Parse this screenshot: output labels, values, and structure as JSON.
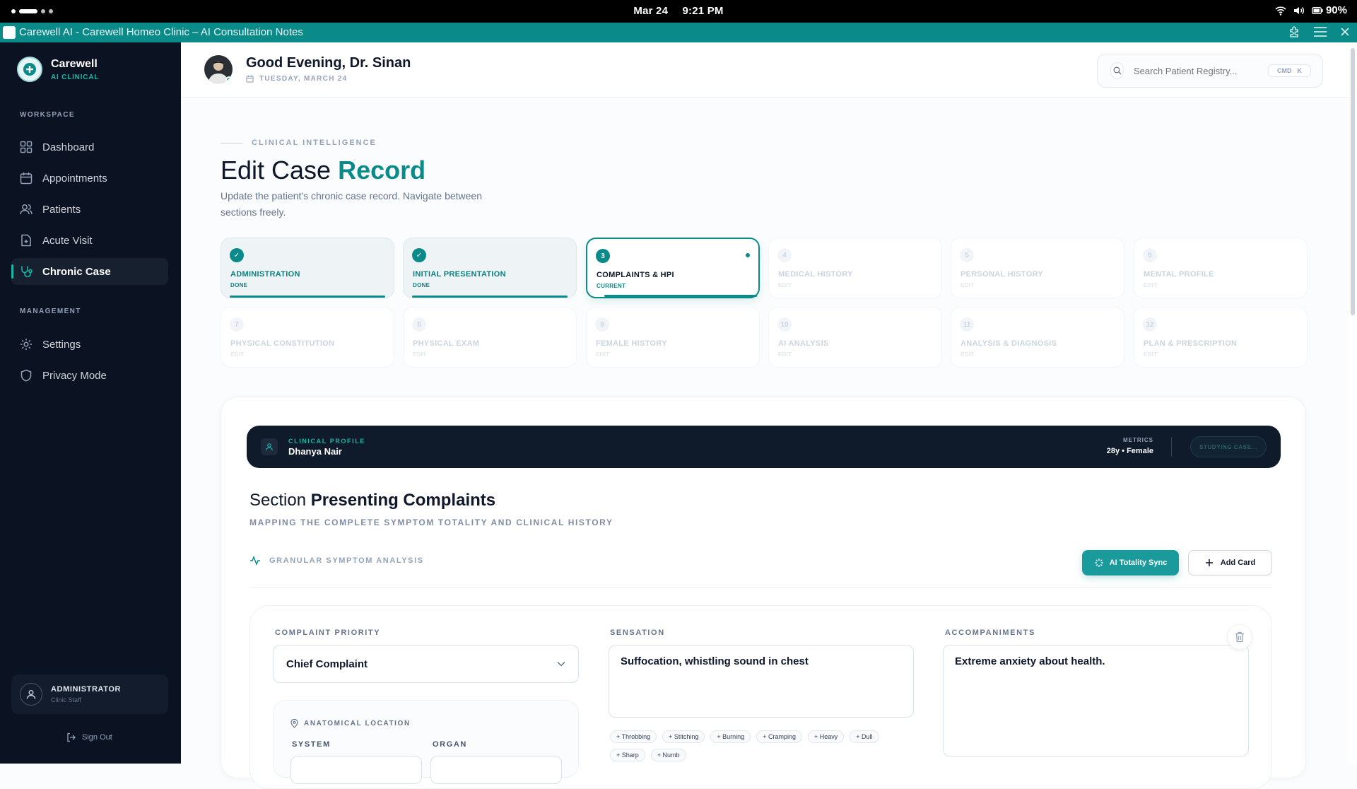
{
  "statusbar": {
    "date": "Mar 24",
    "time": "9:21 PM",
    "battery": "90%"
  },
  "window": {
    "title": "Carewell AI - Carewell Homeo Clinic – AI Consultation Notes"
  },
  "sidebar": {
    "brand": {
      "name": "Carewell",
      "sub": "AI CLINICAL"
    },
    "workspace_label": "WORKSPACE",
    "workspace_items": [
      {
        "label": "Dashboard",
        "icon": "grid-icon"
      },
      {
        "label": "Appointments",
        "icon": "calendar-icon"
      },
      {
        "label": "Patients",
        "icon": "users-icon"
      },
      {
        "label": "Acute Visit",
        "icon": "file-plus-icon"
      },
      {
        "label": "Chronic Case",
        "icon": "stethoscope-icon",
        "active": true
      }
    ],
    "management_label": "MANAGEMENT",
    "management_items": [
      {
        "label": "Settings",
        "icon": "gear-icon"
      },
      {
        "label": "Privacy Mode",
        "icon": "shield-icon"
      }
    ],
    "user": {
      "role": "ADMINISTRATOR",
      "sub": "Clinic Staff"
    },
    "signout": "Sign Out"
  },
  "header": {
    "greeting": "Good Evening, Dr. Sinan",
    "date": "TUESDAY, MARCH 24",
    "search": {
      "placeholder": "Search Patient Registry...",
      "shortcut_mod": "CMD",
      "shortcut_key": "K"
    }
  },
  "page": {
    "eyebrow": "CLINICAL INTELLIGENCE",
    "title_lead": "Edit Case",
    "title_accent": "Record",
    "description": "Update the patient's chronic case record. Navigate between sections freely."
  },
  "steps": [
    {
      "num": "✓",
      "label": "ADMINISTRATION",
      "status": "DONE",
      "state": "done"
    },
    {
      "num": "✓",
      "label": "INITIAL PRESENTATION",
      "status": "DONE",
      "state": "done"
    },
    {
      "num": "3",
      "label": "COMPLAINTS & HPI",
      "status": "CURRENT",
      "state": "current"
    },
    {
      "num": "4",
      "label": "MEDICAL HISTORY",
      "status": "EDIT",
      "state": "todo"
    },
    {
      "num": "5",
      "label": "PERSONAL HISTORY",
      "status": "EDIT",
      "state": "todo"
    },
    {
      "num": "6",
      "label": "MENTAL PROFILE",
      "status": "EDIT",
      "state": "todo"
    },
    {
      "num": "7",
      "label": "PHYSICAL CONSTITUTION",
      "status": "EDIT",
      "state": "todo"
    },
    {
      "num": "8",
      "label": "PHYSICAL EXAM",
      "status": "EDIT",
      "state": "todo"
    },
    {
      "num": "9",
      "label": "FEMALE HISTORY",
      "status": "EDIT",
      "state": "todo"
    },
    {
      "num": "10",
      "label": "AI ANALYSIS",
      "status": "EDIT",
      "state": "todo"
    },
    {
      "num": "11",
      "label": "ANALYSIS & DIAGNOSIS",
      "status": "EDIT",
      "state": "todo"
    },
    {
      "num": "12",
      "label": "PLAN & PRESCRIPTION",
      "status": "EDIT",
      "state": "todo"
    }
  ],
  "profile": {
    "kicker": "CLINICAL PROFILE",
    "name": "Dhanya Nair",
    "metrics_label": "METRICS",
    "metrics": "28y • Female",
    "status_button": "STUDYING CASE..."
  },
  "section": {
    "title_lead": "Section",
    "title_bold": "Presenting Complaints",
    "subtitle": "MAPPING THE COMPLETE SYMPTOM TOTALITY AND CLINICAL HISTORY",
    "granular_label": "GRANULAR SYMPTOM ANALYSIS",
    "ai_button": "AI Totality Sync",
    "add_button": "Add Card"
  },
  "complaint": {
    "priority_label": "COMPLAINT PRIORITY",
    "priority_value": "Chief Complaint",
    "sensation_label": "SENSATION",
    "sensation_value": "Suffocation, whistling sound in chest",
    "accompaniments_label": "ACCOMPANIMENTS",
    "accompaniments_value": "Extreme anxiety about health.",
    "chips": [
      "+ Throbbing",
      "+ Stitching",
      "+ Burning",
      "+ Cramping",
      "+ Heavy",
      "+ Dull",
      "+ Sharp",
      "+ Numb"
    ],
    "location": {
      "title": "ANATOMICAL LOCATION",
      "system_label": "SYSTEM",
      "organ_label": "ORGAN"
    }
  },
  "colors": {
    "accent": "#0b8a8a",
    "sidebar": "#0b1222",
    "titlebar": "#0b8a8a"
  }
}
